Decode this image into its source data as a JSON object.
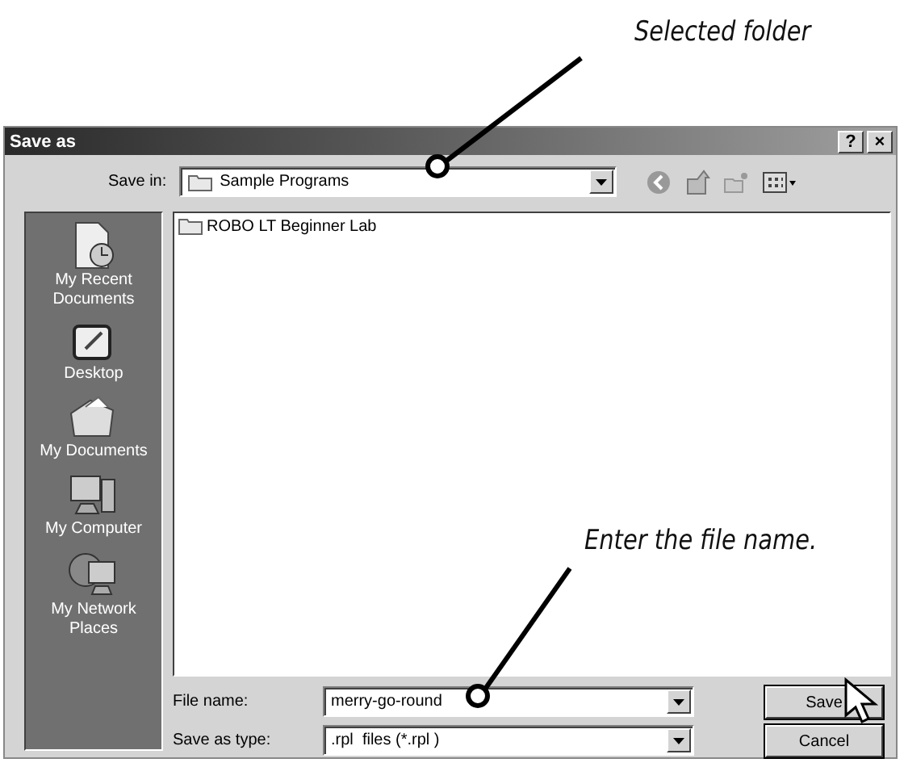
{
  "annotations": [
    {
      "kind": "top",
      "text": "Selected folder"
    },
    {
      "kind": "bottom",
      "text": "Enter the file name."
    }
  ],
  "window": {
    "title": "Save as",
    "title_buttons": [
      "?",
      "×"
    ]
  },
  "save_in": {
    "label": "Save in:",
    "value": "Sample Programs"
  },
  "places": [
    {
      "kind": "recent",
      "label": "My Recent Documents"
    },
    {
      "kind": "desktop",
      "label": "Desktop"
    },
    {
      "kind": "documents",
      "label": "My Documents"
    },
    {
      "kind": "computer",
      "label": "My Computer"
    },
    {
      "kind": "network",
      "label": "My Network Places"
    }
  ],
  "files": [
    {
      "name": "ROBO LT Beginner Lab"
    }
  ],
  "file_name": {
    "label": "File name:",
    "value": "merry-go-round"
  },
  "save_as_type": {
    "label": "Save as type:",
    "value": ".rpl  files (*.rpl )"
  },
  "buttons": [
    "Save",
    "Cancel"
  ]
}
